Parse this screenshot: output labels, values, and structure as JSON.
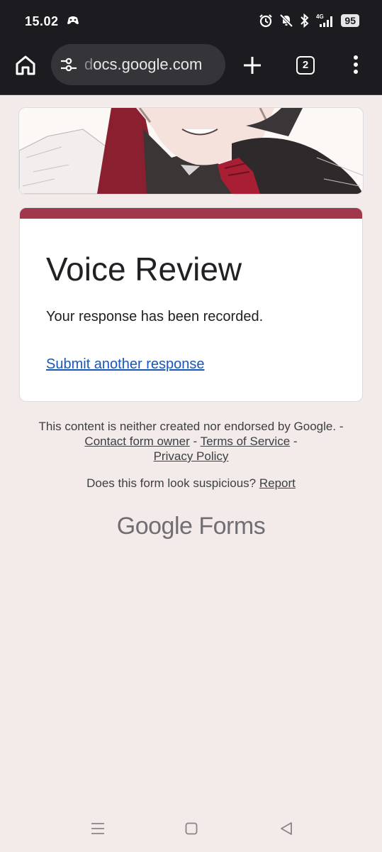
{
  "status": {
    "time": "15.02",
    "network": "4G",
    "battery": "95"
  },
  "browser": {
    "url_prefix": "d",
    "url_main": "ocs.google.com",
    "tab_count": "2"
  },
  "form": {
    "title": "Voice Review",
    "confirmation": "Your response has been recorded.",
    "submit_another": "Submit another response",
    "accent_color": "#a0374a"
  },
  "footer": {
    "disclaimer_prefix": "This content is neither created nor endorsed by Google. - ",
    "contact_owner": "Contact form owner",
    "sep1": " - ",
    "terms": "Terms of Service",
    "sep2": " - ",
    "privacy": "Privacy Policy",
    "suspicious": "Does this form look suspicious? ",
    "report": "Report",
    "brand_google": "Google",
    "brand_forms": " Forms"
  },
  "icons": {
    "home": "home-icon",
    "tune": "site-settings-icon",
    "new_tab": "plus-icon",
    "menu": "more-vert-icon",
    "nav_recents": "recents-icon",
    "nav_home": "home-square-icon",
    "nav_back": "back-triangle-icon"
  }
}
